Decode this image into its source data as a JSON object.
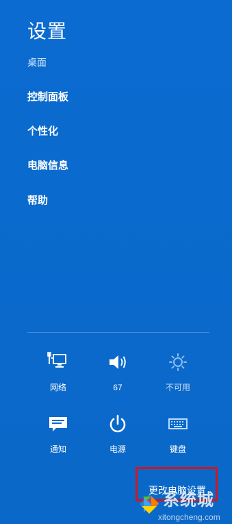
{
  "header": {
    "title": "设置",
    "subtitle": "桌面"
  },
  "menu": {
    "items": [
      {
        "label": "控制面板"
      },
      {
        "label": "个性化"
      },
      {
        "label": "电脑信息"
      },
      {
        "label": "帮助"
      }
    ]
  },
  "quick_settings": {
    "network": {
      "label": "网络",
      "icon": "network-icon"
    },
    "volume": {
      "label": "67",
      "icon": "volume-icon"
    },
    "brightness": {
      "label": "不可用",
      "icon": "brightness-icon"
    },
    "notifications": {
      "label": "通知",
      "icon": "notification-icon"
    },
    "power": {
      "label": "电源",
      "icon": "power-icon"
    },
    "keyboard": {
      "label": "键盘",
      "icon": "keyboard-icon"
    }
  },
  "footer": {
    "change_settings": "更改电脑设置"
  },
  "watermark": {
    "title": "系统城",
    "url": "xitongcheng.com"
  },
  "colors": {
    "background": "#0a69c9",
    "highlight": "#d2161d"
  }
}
